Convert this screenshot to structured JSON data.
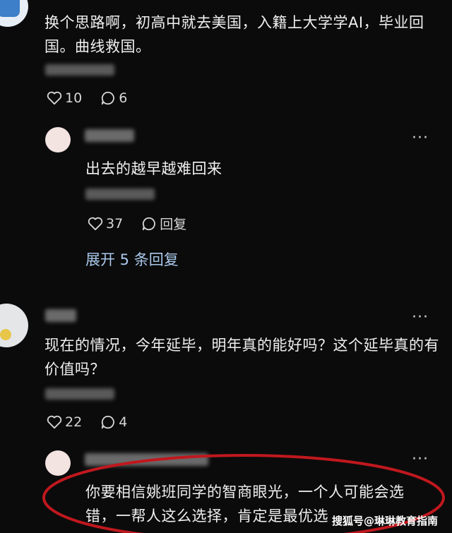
{
  "comments": [
    {
      "text": "换个思路啊，初高中就去美国，入籍上大学学AI，毕业回国。曲线救国。",
      "likes": "10",
      "replies": "6"
    },
    {
      "text": "出去的越早越难回来",
      "likes": "37",
      "reply_label": "回复",
      "expand_label": "展开 5 条回复"
    },
    {
      "text": "现在的情况，今年延毕，明年真的能好吗？这个延毕真的有价值吗？",
      "likes": "22",
      "replies": "4"
    },
    {
      "text": "你要相信姚班同学的智商眼光，一个人可能会选错，一帮人这么选择，肯定是最优选"
    }
  ],
  "more_label": "···",
  "watermark": "搜狐号@琳琳教育指南",
  "colors": {
    "background": "#0b0b0b",
    "annotation": "#c0181e",
    "text": "#f0f0f0"
  }
}
